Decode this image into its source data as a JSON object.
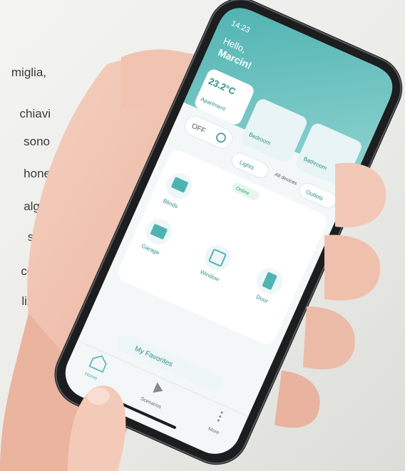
{
  "background_text": {
    "lines": [
      "miglia,",
      "chiavi",
      "sono",
      "hone",
      "algo-",
      "suoi",
      "come",
      "lizza-"
    ]
  },
  "app": {
    "status_time": "14:23",
    "greeting_hello": "Hello,",
    "greeting_name": "Marcin!",
    "temperature": "23.2°C",
    "room_card_label": "Apartment",
    "off_label": "OFF",
    "room_cards": [
      "Bedroom",
      "Bathroom"
    ],
    "filter_chips": [
      "Lights",
      "All devices",
      "Outlets"
    ],
    "status_chip": "Online",
    "devices": [
      "Blinds",
      "Garage",
      "Window",
      "Door"
    ],
    "favorites_label": "My Favorites",
    "nav": {
      "home": "Home",
      "scenarios": "Scenarios",
      "more": "More"
    }
  },
  "colors": {
    "teal": "#5bbfbd",
    "teal_dark": "#2f8f8c",
    "screen_bg": "#f3f7f8",
    "skin": "#f1c4b1"
  }
}
